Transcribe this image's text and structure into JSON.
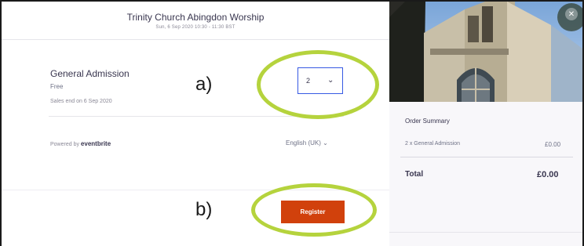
{
  "event": {
    "title": "Trinity Church Abingdon Worship",
    "date": "Sun, 6 Sep 2020 10:30 - 11:30 BST"
  },
  "ticket": {
    "name": "General Admission",
    "price": "Free",
    "sales_end": "Sales end on 6 Sep 2020",
    "quantity": "2"
  },
  "annotations": {
    "a": "a)",
    "b": "b)",
    "highlight_color": "#b5d33d"
  },
  "footer": {
    "powered_prefix": "Powered by",
    "powered_brand": "eventbrite",
    "language": "English (UK)"
  },
  "register_label": "Register",
  "colors": {
    "register": "#d1410c",
    "select_border": "#3659e3"
  },
  "order_summary": {
    "title": "Order Summary",
    "item_label": "2 x General Admission",
    "item_price": "£0.00",
    "total_label": "Total",
    "total_value": "£0.00"
  },
  "close_icon": "close-icon"
}
